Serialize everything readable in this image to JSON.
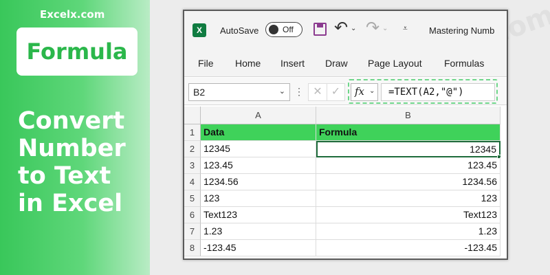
{
  "banner": {
    "brand": "Excelx.com",
    "tag": "Formula",
    "title_lines": [
      "Convert",
      "Number",
      "to Text",
      "in Excel"
    ]
  },
  "watermark": "Excelx.com",
  "titlebar": {
    "logo": "X",
    "autosave_label": "AutoSave",
    "autosave_state": "Off",
    "doc_title": "Mastering Numb"
  },
  "ribbon": {
    "tabs": [
      "File",
      "Home",
      "Insert",
      "Draw",
      "Page Layout",
      "Formulas"
    ]
  },
  "formula_bar": {
    "name_box": "B2",
    "fx": "fx",
    "formula": "=TEXT(A2,\"@\")"
  },
  "sheet": {
    "columns": [
      "A",
      "B"
    ],
    "rows": [
      {
        "num": "1",
        "a": "Data",
        "b": "Formula"
      },
      {
        "num": "2",
        "a": "12345",
        "b": "12345"
      },
      {
        "num": "3",
        "a": "123.45",
        "b": "123.45"
      },
      {
        "num": "4",
        "a": "1234.56",
        "b": "1234.56"
      },
      {
        "num": "5",
        "a": "123",
        "b": "123"
      },
      {
        "num": "6",
        "a": "Text123",
        "b": "Text123"
      },
      {
        "num": "7",
        "a": "1.23",
        "b": "1.23"
      },
      {
        "num": "8",
        "a": "-123.45",
        "b": "-123.45"
      }
    ]
  },
  "colors": {
    "header_fill": "#3fd25a",
    "banner_green": "#39c75a",
    "excel_green": "#107c41"
  }
}
